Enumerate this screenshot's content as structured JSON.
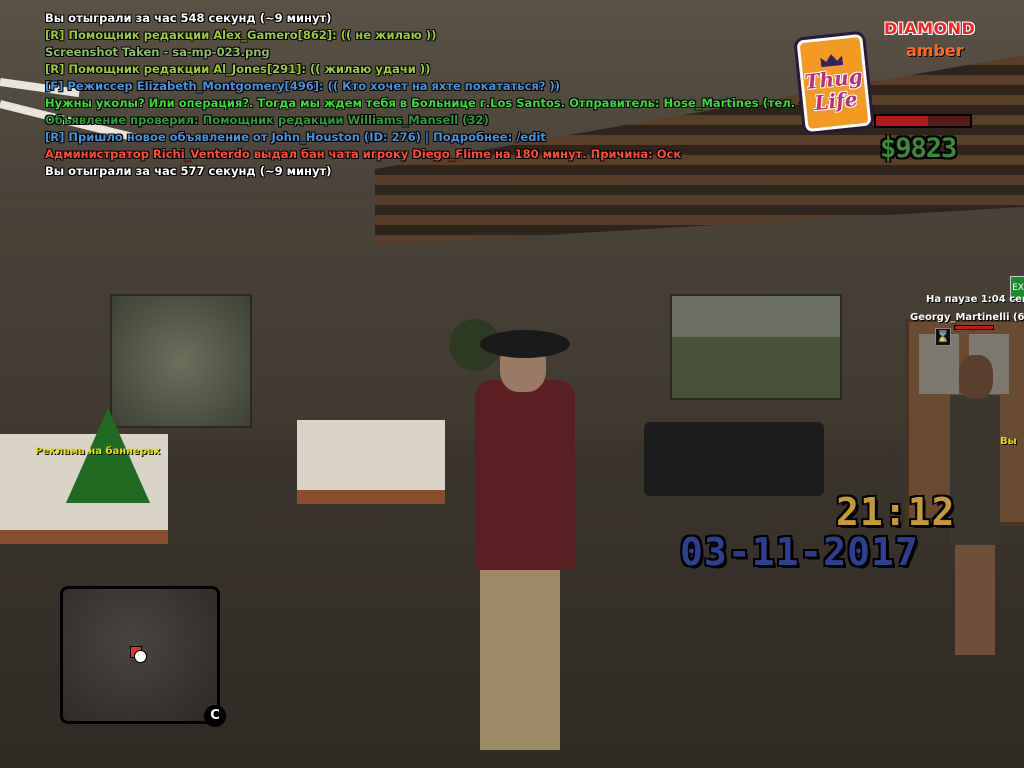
{
  "chat": [
    {
      "text": "Вы отыграли за час 548 секунд (~9 минут)",
      "color": "#ffffff"
    },
    {
      "text": "[R] Помощник редакции Alex_Gamero[862]: (( не жилаю ))",
      "color": "#9acd32"
    },
    {
      "text": "Screenshot Taken - sa-mp-023.png",
      "color": "#8fbc6a"
    },
    {
      "text": "[R] Помощник редакции Al_Jones[291]: (( жилаю удачи ))",
      "color": "#9acd32"
    },
    {
      "text": "[F] Режиссер Elizabeth_Montgomery[496]: (( Кто хочет на яхте покататься? ))",
      "color": "#4a90d9"
    },
    {
      "text": "Нужны уколы? Или операция?. Тогда мы ждем тебя в Больнице г.Los Santos. Отправитель: Hose_Martines (тел. 422649)",
      "color": "#33dd33"
    },
    {
      "text": " Объявление проверил: Помощник редакции Williams_Mansell (32)",
      "color": "#2e9a3a"
    },
    {
      "text": "[R] Пришло новое объявление от John_Houston (ID: 276) | Подробнее: /edit",
      "color": "#4a90d9"
    },
    {
      "text": "Администратор Richi_Venterdo выдал бан чата игроку Diego_Flime на 180 минут. Причина: Оск",
      "color": "#ff4a3a"
    },
    {
      "text": "Вы отыграли за час 577 секунд (~9 минут)",
      "color": "#ffffff"
    }
  ],
  "hud": {
    "server_name": "DIAMOND",
    "server_sub": "amber",
    "logo_text_1": "Thug",
    "logo_text_2": "Life",
    "health_fraction": 0.55,
    "money": "$9823",
    "clock": "21:12",
    "date": "03-11-2017"
  },
  "nametags": {
    "pause": "На паузе 1:04 сек.",
    "player": "Georgy_Martinelli (63",
    "npc_label": "Вы",
    "exit_sign": "EX",
    "banner": "Реклама на баннерах"
  },
  "minimap": {
    "compass": "C"
  },
  "colors": {
    "server_name": "#ff2222",
    "server_sub": "#ff6a1a",
    "money": "#3a8a38",
    "clock": "#c59b2e",
    "date": "#2f3f8f",
    "health": "#b31a1a"
  }
}
